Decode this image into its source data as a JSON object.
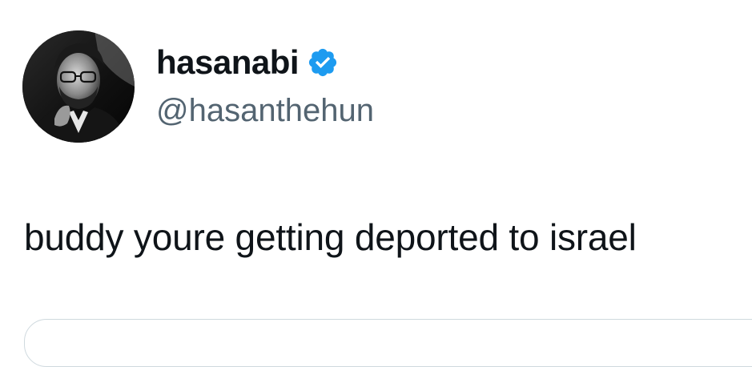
{
  "author": {
    "display_name": "hasanabi",
    "handle": "@hasanthehun",
    "verified": true,
    "verified_color": "#1d9bf0"
  },
  "tweet": {
    "text": "buddy youre getting deported to israel"
  },
  "colors": {
    "text_primary": "#0f1419",
    "text_secondary": "#536471",
    "border": "#cfd9de"
  },
  "icons": {
    "verified": "verified-badge-icon"
  }
}
